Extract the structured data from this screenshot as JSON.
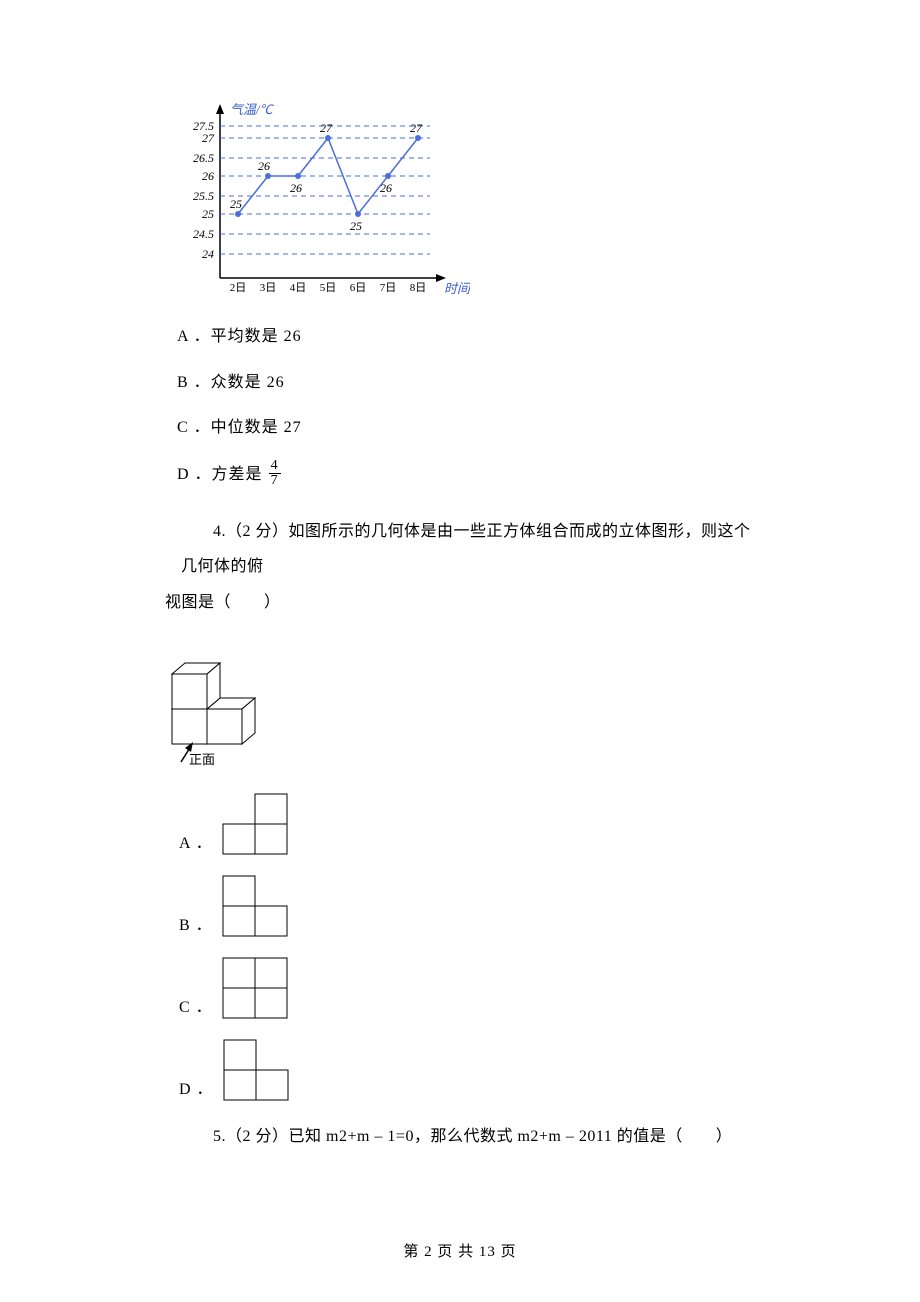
{
  "chart_data": {
    "type": "line",
    "title": "气温/℃",
    "xlabel": "时间",
    "categories": [
      "2日",
      "3日",
      "4日",
      "5日",
      "6日",
      "7日",
      "8日"
    ],
    "values": [
      25,
      26,
      26,
      27,
      25,
      26,
      27
    ],
    "ylim": [
      24,
      27.5
    ],
    "y_ticks": [
      24,
      24.5,
      25,
      25.5,
      26,
      26.5,
      27,
      27.5
    ],
    "point_labels": [
      "25",
      "26",
      "26",
      "27",
      "25",
      "26",
      "27"
    ]
  },
  "q3": {
    "optA": "A ．平均数是 26",
    "optB": "B ．众数是 26",
    "optC": "C ．中位数是 27",
    "optD_prefix": "D ．方差是",
    "frac_num": "4",
    "frac_den": "7"
  },
  "q4": {
    "line1": "4.（2 分）如图所示的几何体是由一些正方体组合而成的立体图形，则这个几何体的俯",
    "line2": "视图是（　　）",
    "front_label": "正面",
    "optA": "A ．",
    "optB": "B ．",
    "optC": "C ．",
    "optD": "D ．"
  },
  "q5": {
    "text": "5.（2 分）已知 m2+m – 1=0，那么代数式 m2+m – 2011 的值是（　　）"
  },
  "footer": {
    "text": "第 2 页 共 13 页"
  }
}
